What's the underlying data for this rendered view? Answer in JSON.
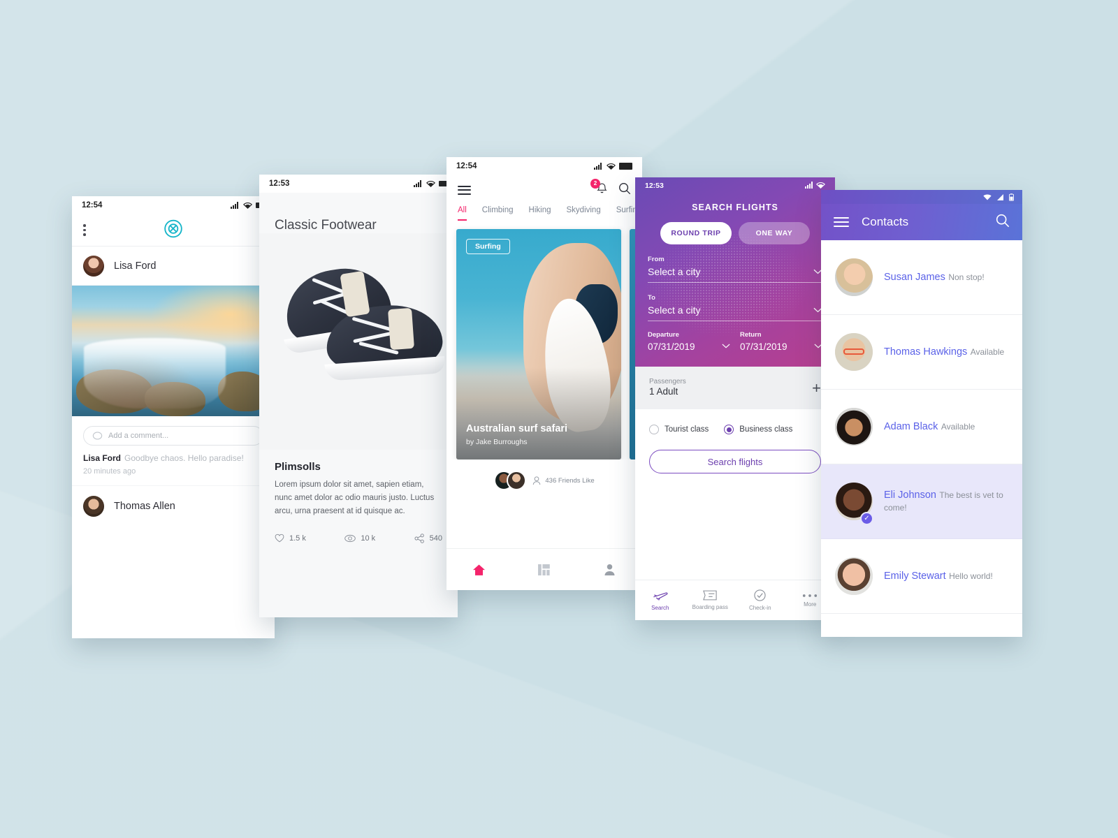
{
  "background": {
    "color": "#cce0e6"
  },
  "social": {
    "status": {
      "time": "12:54"
    },
    "appbar": {
      "menu_icon": "kebab-menu-icon",
      "logo_icon": "brand-logo-icon",
      "logo_color": "#16b5c9"
    },
    "author": {
      "name": "Lisa Ford"
    },
    "comment_placeholder": "Add a comment...",
    "caption_author": "Lisa Ford",
    "caption_text": "Goodbye chaos. Hello paradise!",
    "timestamp": "20 minutes ago",
    "author2": {
      "name": "Thomas Allen"
    }
  },
  "shop": {
    "status": {
      "time": "12:53"
    },
    "title": "Classic Footwear",
    "product_name": "Plimsolls",
    "description": "Lorem ipsum dolor sit amet, sapien etiam, nunc amet dolor ac odio mauris justo. Luctus arcu, urna praesent at id quisque ac.",
    "stats": [
      {
        "icon": "heart-icon",
        "value": "1.5 k"
      },
      {
        "icon": "eye-icon",
        "value": "10 k"
      },
      {
        "icon": "share-icon",
        "value": "540"
      }
    ]
  },
  "adventure": {
    "status": {
      "time": "12:54"
    },
    "menu_icon": "hamburger-menu-icon",
    "notification_count": "2",
    "accent_color": "#f4246b",
    "tabs": [
      {
        "label": "All",
        "active": true
      },
      {
        "label": "Climbing",
        "active": false
      },
      {
        "label": "Hiking",
        "active": false
      },
      {
        "label": "Skydiving",
        "active": false
      },
      {
        "label": "Surfing",
        "active": false
      }
    ],
    "card": {
      "chip": "Surfing",
      "title": "Australian surf safari",
      "byline": "by Jake Burroughs"
    },
    "friends_label": "436 Friends Like",
    "nav": [
      {
        "icon": "home-icon",
        "active": true
      },
      {
        "icon": "grid-icon",
        "active": false
      },
      {
        "icon": "person-icon",
        "active": false
      }
    ]
  },
  "flights": {
    "status": {
      "time": "12:53"
    },
    "title": "SEARCH FLIGHTS",
    "accent_color": "#6c3fae",
    "trip_types": [
      {
        "label": "ROUND TRIP",
        "selected": true
      },
      {
        "label": "ONE WAY",
        "selected": false
      }
    ],
    "from": {
      "label": "From",
      "value": "Select a city"
    },
    "to": {
      "label": "To",
      "value": "Select a city"
    },
    "departure": {
      "label": "Departure",
      "value": "07/31/2019"
    },
    "return": {
      "label": "Return",
      "value": "07/31/2019"
    },
    "passengers": {
      "label": "Passengers",
      "value": "1 Adult",
      "add_icon": "plus-icon"
    },
    "classes": [
      {
        "label": "Tourist class",
        "selected": false
      },
      {
        "label": "Business class",
        "selected": true
      }
    ],
    "cta": "Search flights",
    "nav": [
      {
        "label": "Search",
        "icon": "airplane-icon",
        "active": true
      },
      {
        "label": "Boarding pass",
        "icon": "ticket-icon",
        "active": false
      },
      {
        "label": "Check-in",
        "icon": "check-circle-icon",
        "active": false
      },
      {
        "label": "More",
        "icon": "ellipsis-icon",
        "active": false
      }
    ]
  },
  "contacts": {
    "title": "Contacts",
    "menu_icon": "hamburger-menu-icon",
    "search_icon": "search-icon",
    "accent_color": "#5b62e8",
    "items": [
      {
        "name": "Susan James",
        "status": "Non stop!",
        "selected": false
      },
      {
        "name": "Thomas Hawkings",
        "status": "Available",
        "selected": false
      },
      {
        "name": "Adam Black",
        "status": "Available",
        "selected": false
      },
      {
        "name": "Eli Johnson",
        "status": "The best is vet to come!",
        "selected": true
      },
      {
        "name": "Emily Stewart",
        "status": "Hello world!",
        "selected": false
      }
    ]
  }
}
